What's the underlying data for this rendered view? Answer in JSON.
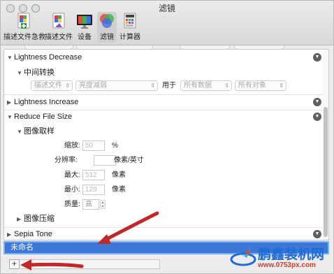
{
  "window": {
    "title": "滤镜"
  },
  "toolbar": {
    "items": [
      {
        "label": "描述文件急救",
        "icon": "profile-firstaid-icon"
      },
      {
        "label": "描述文件",
        "icon": "profile-icon"
      },
      {
        "label": "设备",
        "icon": "display-icon"
      },
      {
        "label": "滤镜",
        "icon": "filter-icon",
        "selected": true
      },
      {
        "label": "计算器",
        "icon": "calculator-icon"
      }
    ]
  },
  "filters": {
    "lightness_decrease": {
      "title": "Lightness Decrease",
      "subsection": "中间转换",
      "source": "描述文件",
      "method": "亮度减弱",
      "for_label": "用于",
      "data_select": "所有数据",
      "object_select": "所有对象"
    },
    "lightness_increase": {
      "title": "Lightness Increase"
    },
    "reduce_file_size": {
      "title": "Reduce File Size",
      "resample": {
        "title": "图像取样",
        "scale_label": "缩放:",
        "scale_value": "50",
        "scale_unit": "%",
        "resolution_label": "分辨率:",
        "resolution_value": "",
        "resolution_unit": "像素/英寸",
        "max_label": "最大:",
        "max_value": "512",
        "max_unit": "像素",
        "min_label": "最小:",
        "min_value": "128",
        "min_unit": "像素",
        "quality_label": "质量:",
        "quality_value": "高"
      },
      "compression": {
        "title": "图像压缩"
      }
    },
    "sepia_tone": {
      "title": "Sepia Tone"
    }
  },
  "name_field": {
    "value": "未命名"
  },
  "bottom": {
    "add_label": "+"
  },
  "watermark": {
    "line1": "鹏鑫装机网",
    "line2": "www.0753px.com"
  },
  "colors": {
    "selection": "#3c78d8",
    "arrow": "#c0282a",
    "accent": "#1e6bd6"
  }
}
